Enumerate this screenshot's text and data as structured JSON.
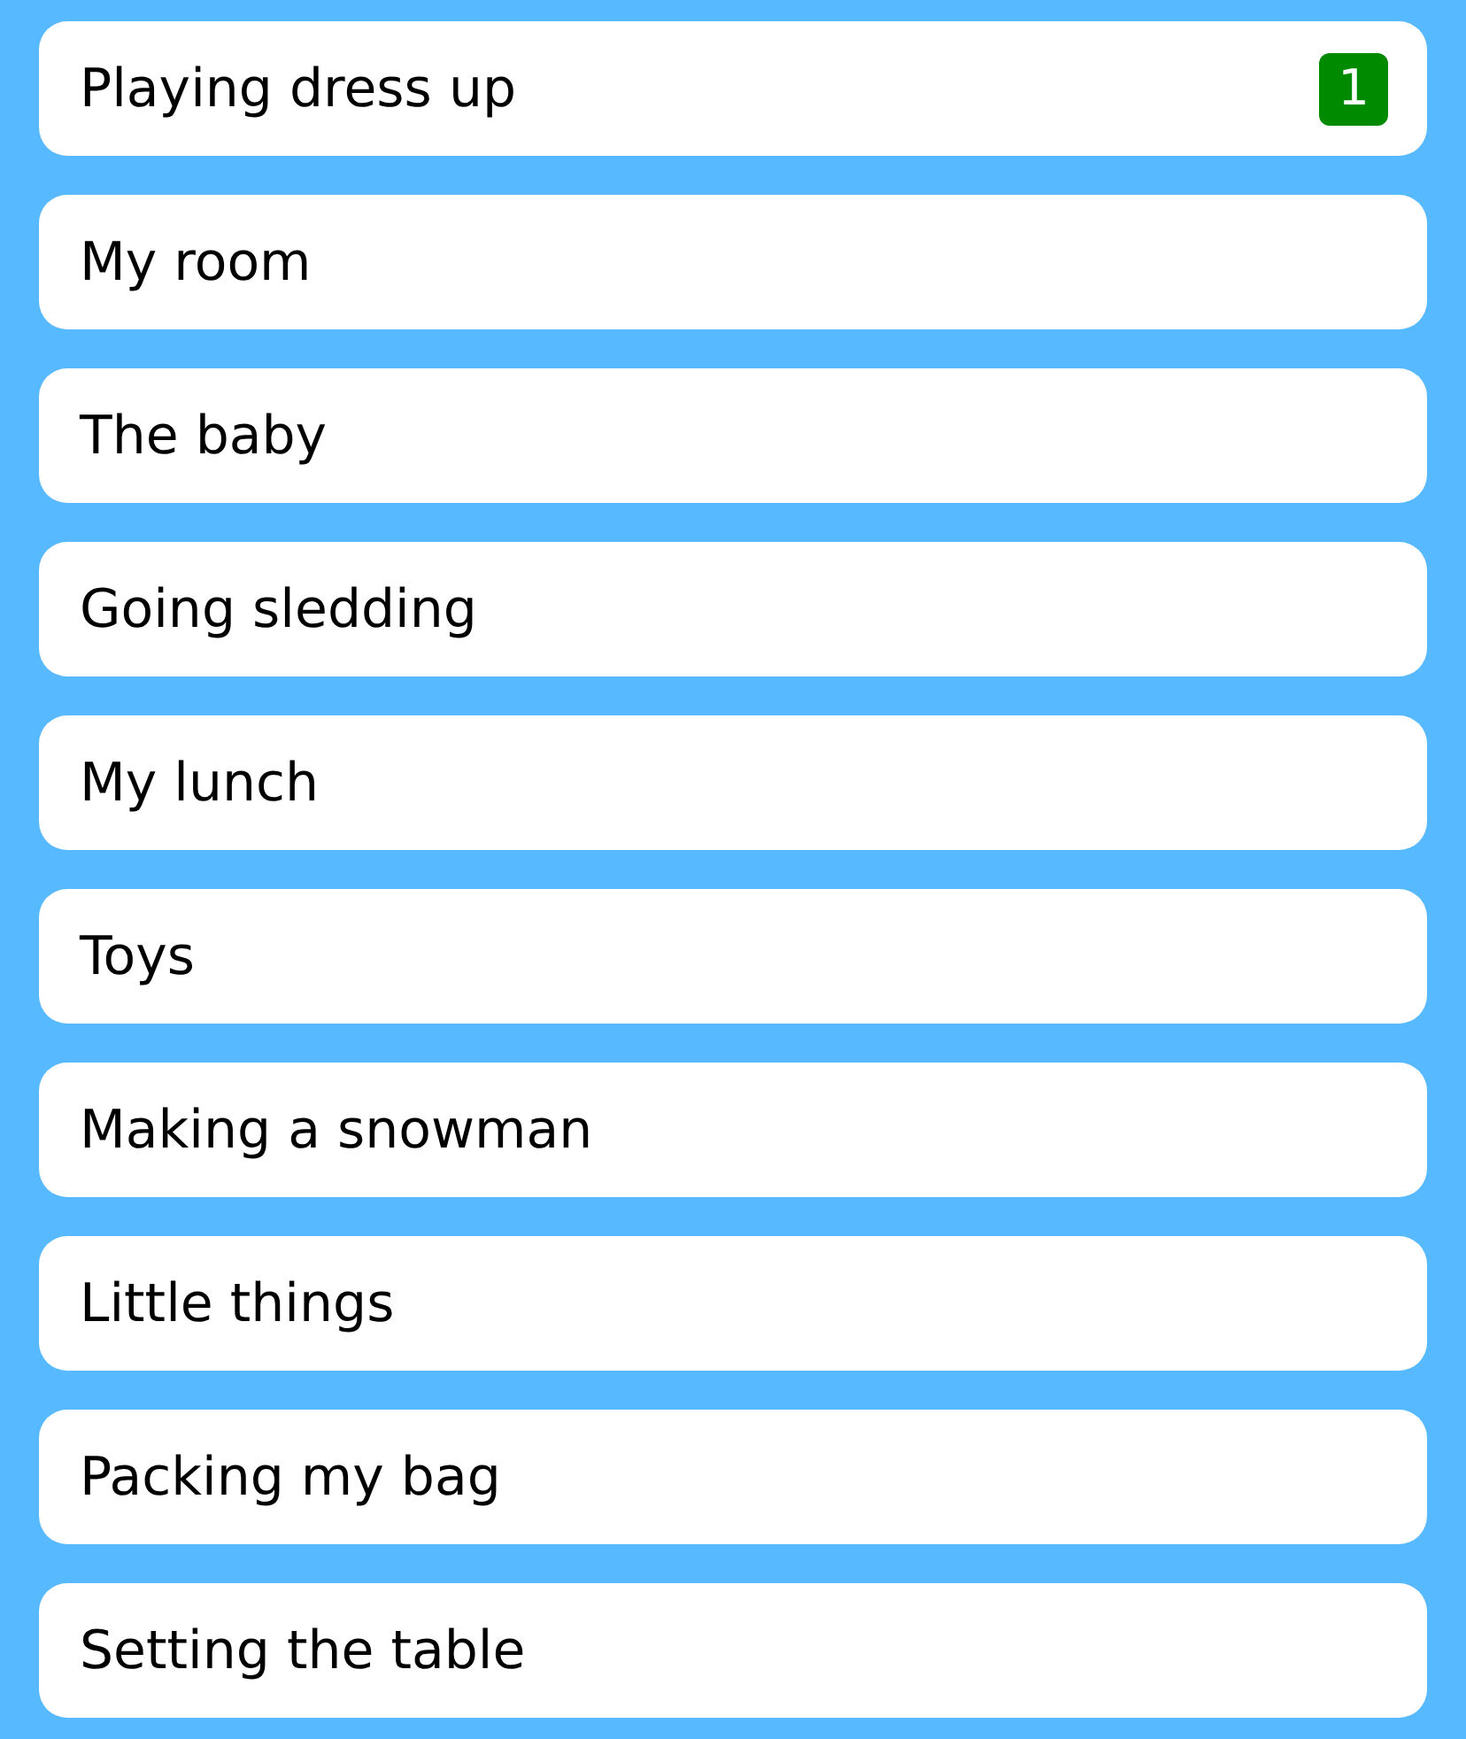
{
  "items": [
    {
      "label": "Playing dress up",
      "badge": "1"
    },
    {
      "label": "My room"
    },
    {
      "label": "The baby"
    },
    {
      "label": "Going sledding"
    },
    {
      "label": "My lunch"
    },
    {
      "label": "Toys"
    },
    {
      "label": "Making a snowman"
    },
    {
      "label": "Little things"
    },
    {
      "label": "Packing my bag"
    },
    {
      "label": "Setting the table"
    }
  ]
}
